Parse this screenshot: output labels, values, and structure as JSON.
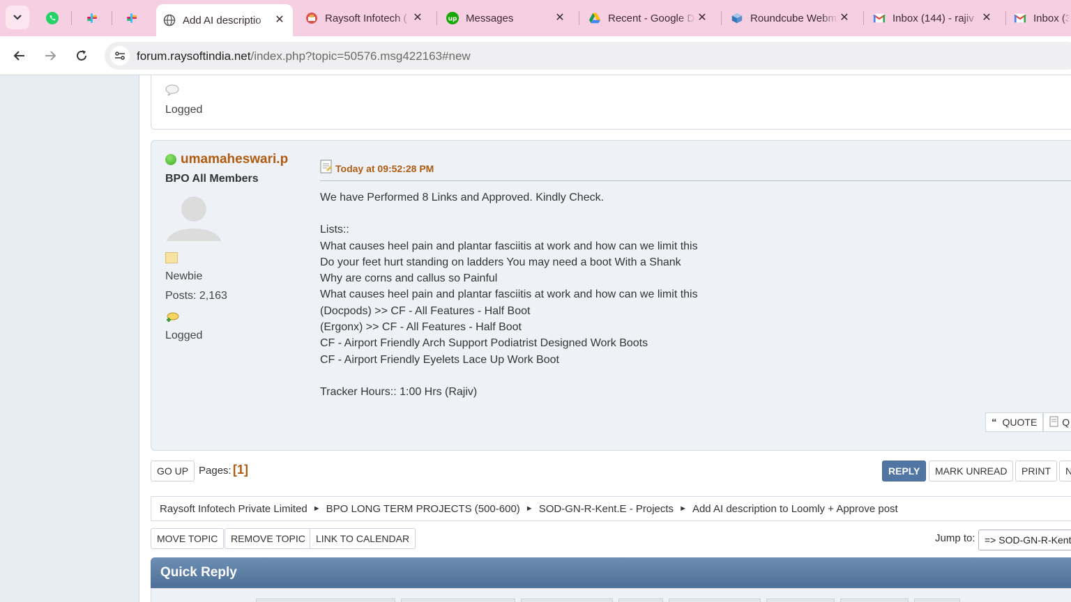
{
  "browser": {
    "tabs": [
      {
        "title": "Add AI descriptio",
        "icon": "globe-icon",
        "active": true
      },
      {
        "title": "Raysoft Infotech (",
        "icon": "raysoft-icon"
      },
      {
        "title": "Messages",
        "icon": "upwork-icon"
      },
      {
        "title": "Recent - Google D",
        "icon": "google-drive-icon"
      },
      {
        "title": "Roundcube Webm",
        "icon": "roundcube-icon"
      },
      {
        "title": "Inbox (144) - rajiv",
        "icon": "gmail-icon"
      },
      {
        "title": "Inbox (3",
        "icon": "gmail-icon"
      }
    ],
    "pinned_icons": [
      "whatsapp-icon",
      "slack-icon",
      "slack-icon"
    ],
    "close_glyph": "✕",
    "url_host": "forum.raysoftindia.net",
    "url_path": "/index.php?topic=50576.msg422163#new"
  },
  "prev_post": {
    "logged": "Logged"
  },
  "post": {
    "username": "umamaheswari.p",
    "group": "BPO All Members",
    "rank": "Newbie",
    "posts": "Posts: 2,163",
    "logged": "Logged",
    "date": "Today at 09:52:28 PM",
    "body": {
      "intro": "We have Performed 8 Links and Approved. Kindly Check.",
      "lists_label": "Lists::",
      "lines": [
        "What causes heel pain and plantar fasciitis at work and how can we limit this",
        "Do your feet hurt standing on ladders  You may need a boot With a Shank",
        "Why are corns and callus so Painful",
        "What causes heel pain and plantar fasciitis at work and how can we limit this",
        "(Docpods) >> CF - All Features - Half Boot",
        "(Ergonx) >> CF - All Features - Half Boot",
        "CF - Airport Friendly Arch Support Podiatrist Designed Work Boots",
        "CF - Airport Friendly Eyelets Lace Up Work Boot"
      ],
      "tracker": "Tracker Hours:: 1:00 Hrs (Rajiv)"
    },
    "quote_label": "QUOTE",
    "quote2_label": "Q"
  },
  "nav": {
    "go_up": "GO UP",
    "pages_label": "Pages:",
    "pages_value": "[1]",
    "reply": "REPLY",
    "mark_unread": "MARK UNREAD",
    "print": "PRINT",
    "more": "N"
  },
  "breadcrumb": [
    "Raysoft Infotech Private Limited",
    "BPO LONG TERM PROJECTS (500-600)",
    "SOD-GN-R-Kent.E - Projects",
    "Add AI description to Loomly + Approve post"
  ],
  "breadcrumb_sep": "►",
  "moderation": {
    "move_topic": "MOVE TOPIC",
    "remove_topic": "REMOVE TOPIC",
    "link_to_calendar": "LINK TO CALENDAR",
    "jump_label": "Jump to:",
    "jump_value": "=> SOD-GN-R-Kent"
  },
  "quick_reply": {
    "title": "Quick Reply"
  },
  "colors": {
    "accent": "#b05b10",
    "reply_button": "#5176a3",
    "tabbar": "#f7cfe3"
  }
}
